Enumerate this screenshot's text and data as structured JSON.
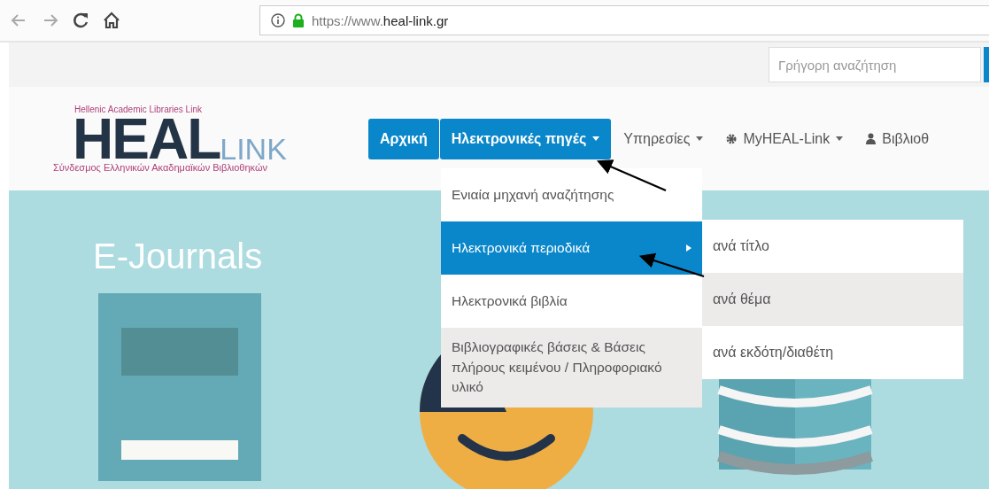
{
  "browser": {
    "url_prefix": "https://www.",
    "url_domain": "heal-link.gr"
  },
  "top_bar": {
    "search": {
      "placeholder": "Γρήγορη αναζήτηση"
    }
  },
  "logo": {
    "tagline_top": "Hellenic Academic Libraries Link",
    "word_main": "HEAL",
    "word_side": "LINK",
    "tagline_bottom": "Σύνδεσμος Ελληνικών Ακαδημαϊκών Βιβλιοθηκών"
  },
  "nav": [
    {
      "label": "Αρχική",
      "selected": true,
      "caret": false
    },
    {
      "label": "Ηλεκτρονικές πηγές",
      "selected": true,
      "caret": true
    },
    {
      "label": "Υπηρεσίες",
      "selected": false,
      "caret": true
    },
    {
      "label": "MyHEAL-Link",
      "selected": false,
      "caret": true
    },
    {
      "label": "Βιβλιοθ",
      "selected": false,
      "caret": false
    }
  ],
  "dropdown": [
    {
      "label": "Ενιαία μηχανή αναζήτησης",
      "selected": false,
      "highlighted": false,
      "submenu": false
    },
    {
      "label": "Ηλεκτρονικά περιοδικά",
      "selected": true,
      "highlighted": false,
      "submenu": true
    },
    {
      "label": "Ηλεκτρονικά βιβλία",
      "selected": false,
      "highlighted": false,
      "submenu": false
    },
    {
      "label": "Βιβλιογραφικές βάσεις & Βάσεις πλήρους κειμένου / Πληροφοριακό υλικό",
      "selected": false,
      "highlighted": true,
      "submenu": false
    }
  ],
  "submenu": [
    {
      "label": "ανά τίτλο",
      "selected": false,
      "highlighted": false
    },
    {
      "label": "ανά θέμα",
      "selected": false,
      "highlighted": true
    },
    {
      "label": "ανά εκδότη/διαθέτη",
      "selected": false,
      "highlighted": false
    }
  ],
  "hero": {
    "title": "E-Journals"
  }
}
